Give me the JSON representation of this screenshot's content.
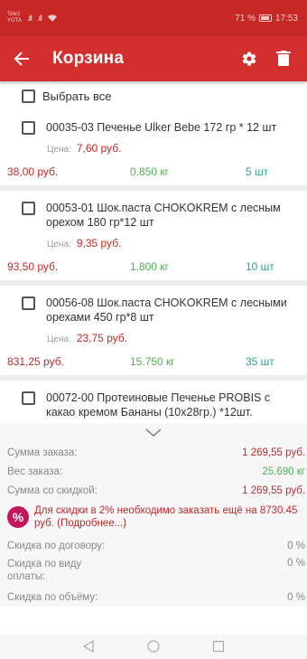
{
  "status_bar": {
    "carrier_line1": "Tele2",
    "carrier_line2": "YOTA",
    "signal1": ".ıll",
    "signal2": ".ıll",
    "battery_text": "71 %",
    "time": "17:53"
  },
  "app_bar": {
    "title": "Корзина",
    "icons": [
      "arrow-back-icon",
      "gear-icon",
      "trash-icon"
    ]
  },
  "select_all": {
    "label": "Выбрать все"
  },
  "items": [
    {
      "name": "00035-03 Печенье Ulker Bebe 172 гр * 12 шт",
      "price_label": "Цена:",
      "price": "7,60 руб.",
      "sum": "38,00 руб.",
      "weight": "0.850 кг",
      "qty": "5 шт"
    },
    {
      "name": "00053-01 Шок.паста CHOKOKREM с лесным орехом 180 гр*12 шт",
      "price_label": "Цена:",
      "price": "9,35 руб.",
      "sum": "93,50 руб.",
      "weight": "1.800 кг",
      "qty": "10 шт"
    },
    {
      "name": "00056-08 Шок.паста CHOKOKREM с лесными орехами 450 гр*8 шт",
      "price_label": "Цена:",
      "price": "23,75 руб.",
      "sum": "831,25 руб.",
      "weight": "15.750 кг",
      "qty": "35 шт"
    },
    {
      "name": "00072-00 Протеиновые Печенье PROBIS с какао кремом Бананы (10х28гр.) *12шт."
    }
  ],
  "summary": {
    "order_sum_label": "Сумма заказа:",
    "order_sum": "1 269,55 руб.",
    "order_weight_label": "Вес заказа:",
    "order_weight": "25.690 кг",
    "discount_sum_label": "Сумма со скидкой:",
    "discount_sum": "1 269,55 руб.",
    "promo_icon": "%",
    "promo_text": "Для скидки в 2% необходимо заказать ещё на 8730.45 руб. (Подробнее...)",
    "contract_discount_label": "Скидка по договору:",
    "contract_discount": "0 %",
    "payment_discount_label": "Скидка по виду оплаты:",
    "payment_discount": "0 %",
    "volume_discount_label": "Скидка по объёму:",
    "volume_discount": "0 %"
  },
  "colors": {
    "status_bar": "#c62828",
    "app_bar": "#d32f2f",
    "price": "#c62828",
    "weight": "#4caf50",
    "qty": "#26a69a",
    "promo_icon": "#c2185b"
  }
}
